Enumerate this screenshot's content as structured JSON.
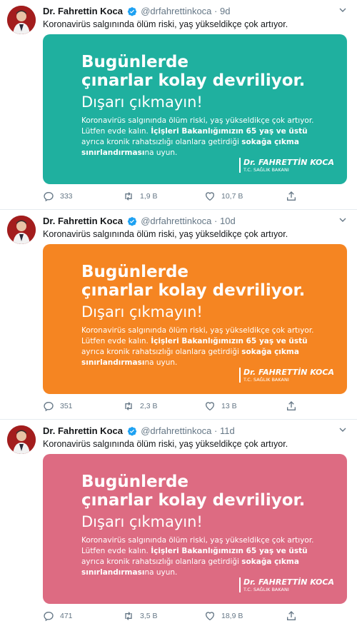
{
  "tweets": [
    {
      "author_name": "Dr. Fahrettin Koca",
      "handle": "@drfahrettinkoca",
      "separator": "·",
      "time": "9d",
      "text": "Koronavirüs salgınında ölüm riski, yaş yükseldikçe çok artıyor.",
      "card_color": "#1fb09f",
      "card": {
        "headline_line1": "Bugünlerde",
        "headline_line2": "çınarlar kolay devriliyor.",
        "subheadline": "Dışarı çıkmayın!",
        "body_line1": "Koronavirüs salgınında ölüm riski, yaş yükseldikçe çok artıyor.",
        "body_line2_pre": "Lütfen evde kalın. ",
        "body_line2_bold": "İçişleri Bakanlığımızın 65 yaş ve üstü",
        "body_line3_pre": "ayrıca kronik rahatsızlığı olanlara getirdiği ",
        "body_line3_bold": "sokağa çıkma",
        "body_line4_bold": "sınırlandırması",
        "body_line4_post": "na uyun.",
        "signature_name": "Dr. FAHRETTİN KOCA",
        "signature_title": "T.C. SAĞLIK BAKANI"
      },
      "replies": "333",
      "retweets": "1,9 B",
      "likes": "10,7 B"
    },
    {
      "author_name": "Dr. Fahrettin Koca",
      "handle": "@drfahrettinkoca",
      "separator": "·",
      "time": "10d",
      "text": "Koronavirüs salgınında ölüm riski, yaş yükseldikçe çok artıyor.",
      "card_color": "#f58522",
      "card": {
        "headline_line1": "Bugünlerde",
        "headline_line2": "çınarlar kolay devriliyor.",
        "subheadline": "Dışarı çıkmayın!",
        "body_line1": "Koronavirüs salgınında ölüm riski, yaş yükseldikçe çok artıyor.",
        "body_line2_pre": "Lütfen evde kalın. ",
        "body_line2_bold": "İçişleri Bakanlığımızın 65 yaş ve üstü",
        "body_line3_pre": "ayrıca kronik rahatsızlığı olanlara getirdiği ",
        "body_line3_bold": "sokağa çıkma",
        "body_line4_bold": "sınırlandırması",
        "body_line4_post": "na uyun.",
        "signature_name": "Dr. FAHRETTİN KOCA",
        "signature_title": "T.C. SAĞLIK BAKANI"
      },
      "replies": "351",
      "retweets": "2,3 B",
      "likes": "13 B"
    },
    {
      "author_name": "Dr. Fahrettin Koca",
      "handle": "@drfahrettinkoca",
      "separator": "·",
      "time": "11d",
      "text": "Koronavirüs salgınında ölüm riski, yaş yükseldikçe çok artıyor.",
      "card_color": "#dd6b82",
      "card": {
        "headline_line1": "Bugünlerde",
        "headline_line2": "çınarlar kolay devriliyor.",
        "subheadline": "Dışarı çıkmayın!",
        "body_line1": "Koronavirüs salgınında ölüm riski, yaş yükseldikçe çok artıyor.",
        "body_line2_pre": "Lütfen evde kalın. ",
        "body_line2_bold": "İçişleri Bakanlığımızın 65 yaş ve üstü",
        "body_line3_pre": "ayrıca kronik rahatsızlığı olanlara getirdiği ",
        "body_line3_bold": "sokağa çıkma",
        "body_line4_bold": "sınırlandırması",
        "body_line4_post": "na uyun.",
        "signature_name": "Dr. FAHRETTİN KOCA",
        "signature_title": "T.C. SAĞLIK BAKANI"
      },
      "replies": "471",
      "retweets": "3,5 B",
      "likes": "18,9 B"
    }
  ],
  "icons": {
    "reply": "reply-icon",
    "retweet": "retweet-icon",
    "like": "heart-icon",
    "share": "share-icon",
    "verified": "verified-badge-icon",
    "more": "chevron-down-icon"
  },
  "colors": {
    "verified": "#1da1f2",
    "secondary_text": "#657786"
  }
}
